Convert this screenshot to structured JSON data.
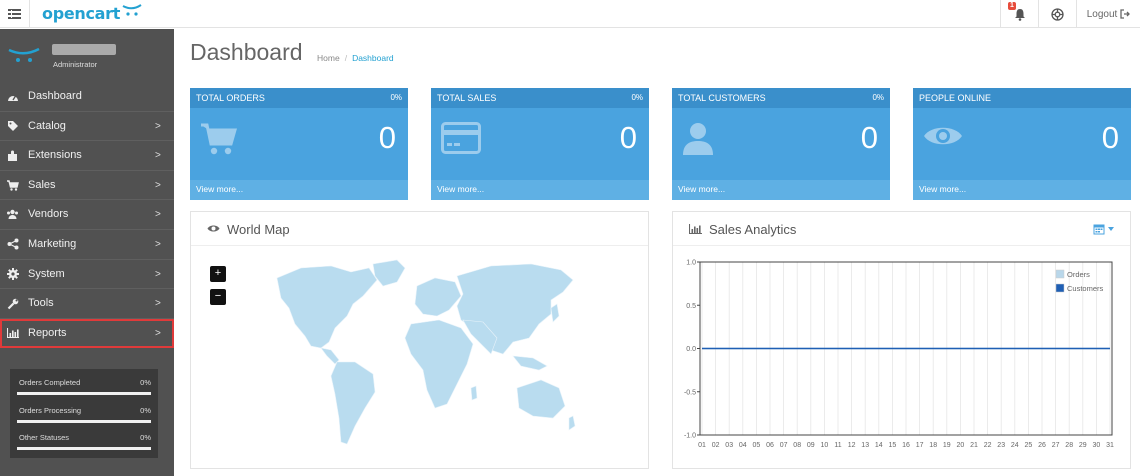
{
  "header": {
    "brand": "opencart",
    "notification_count": "1",
    "logout_label": "Logout"
  },
  "sidebar": {
    "user_role": "Administrator",
    "items": [
      {
        "label": "Dashboard",
        "icon": "dashboard-icon",
        "has_arrow": false
      },
      {
        "label": "Catalog",
        "icon": "tag-icon",
        "has_arrow": true
      },
      {
        "label": "Extensions",
        "icon": "puzzle-icon",
        "has_arrow": true
      },
      {
        "label": "Sales",
        "icon": "cart-icon",
        "has_arrow": true
      },
      {
        "label": "Vendors",
        "icon": "users-icon",
        "has_arrow": true
      },
      {
        "label": "Marketing",
        "icon": "share-icon",
        "has_arrow": true
      },
      {
        "label": "System",
        "icon": "gear-icon",
        "has_arrow": true
      },
      {
        "label": "Tools",
        "icon": "wrench-icon",
        "has_arrow": true
      },
      {
        "label": "Reports",
        "icon": "bar-chart-icon",
        "has_arrow": true
      }
    ],
    "stats": [
      {
        "label": "Orders Completed",
        "value": "0%"
      },
      {
        "label": "Orders Processing",
        "value": "0%"
      },
      {
        "label": "Other Statuses",
        "value": "0%"
      }
    ]
  },
  "page": {
    "title": "Dashboard",
    "breadcrumb": [
      "Home",
      "Dashboard"
    ]
  },
  "tiles": [
    {
      "title": "TOTAL ORDERS",
      "percent": "0%",
      "value": "0",
      "more": "View more...",
      "icon": "cart-icon"
    },
    {
      "title": "TOTAL SALES",
      "percent": "0%",
      "value": "0",
      "more": "View more...",
      "icon": "credit-card-icon"
    },
    {
      "title": "TOTAL CUSTOMERS",
      "percent": "0%",
      "value": "0",
      "more": "View more...",
      "icon": "user-icon"
    },
    {
      "title": "PEOPLE ONLINE",
      "percent": "",
      "value": "0",
      "more": "View more...",
      "icon": "eye-icon"
    }
  ],
  "world_map": {
    "title": "World Map",
    "zoom_in": "+",
    "zoom_out": "−"
  },
  "chart_data": {
    "type": "line",
    "title": "Sales Analytics",
    "x": [
      "01",
      "02",
      "03",
      "04",
      "05",
      "06",
      "07",
      "08",
      "09",
      "10",
      "11",
      "12",
      "13",
      "14",
      "15",
      "16",
      "17",
      "18",
      "19",
      "20",
      "21",
      "22",
      "23",
      "24",
      "25",
      "26",
      "27",
      "28",
      "29",
      "30",
      "31"
    ],
    "ylim": [
      -1.0,
      1.0
    ],
    "yticks": [
      "1.0",
      "0.5",
      "0.0",
      "-0.5",
      "-1.0"
    ],
    "grid": true,
    "legend_position": "top-right",
    "series": [
      {
        "name": "Orders",
        "color": "#b9d7ea",
        "values": [
          0,
          0,
          0,
          0,
          0,
          0,
          0,
          0,
          0,
          0,
          0,
          0,
          0,
          0,
          0,
          0,
          0,
          0,
          0,
          0,
          0,
          0,
          0,
          0,
          0,
          0,
          0,
          0,
          0,
          0,
          0
        ]
      },
      {
        "name": "Customers",
        "color": "#1f5fb4",
        "values": [
          0,
          0,
          0,
          0,
          0,
          0,
          0,
          0,
          0,
          0,
          0,
          0,
          0,
          0,
          0,
          0,
          0,
          0,
          0,
          0,
          0,
          0,
          0,
          0,
          0,
          0,
          0,
          0,
          0,
          0,
          0
        ]
      }
    ]
  },
  "colors": {
    "brand": "#23a1d1",
    "sidebar": "#515151",
    "tile": "#4aa3df",
    "highlight": "#e03a3a"
  }
}
